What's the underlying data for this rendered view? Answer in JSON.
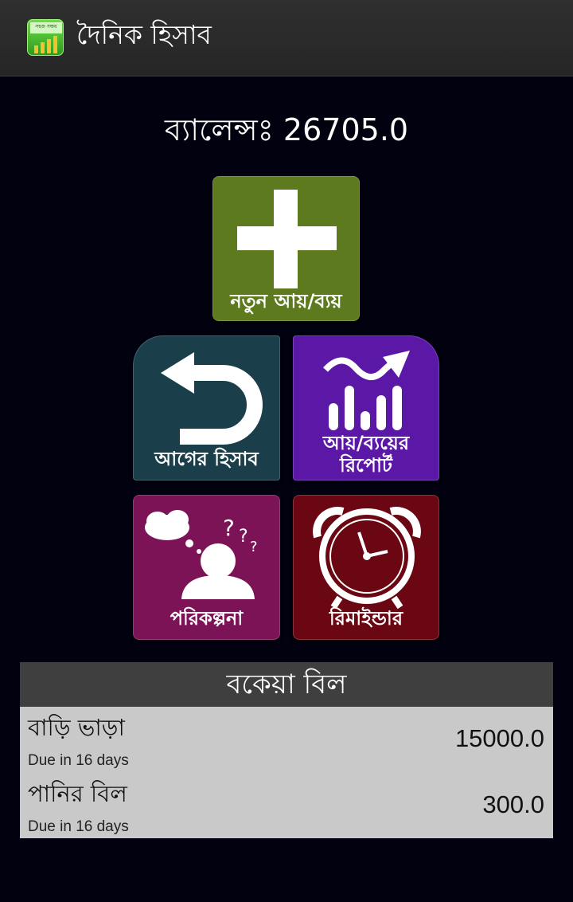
{
  "app": {
    "title": "দৈনিক হিসাব",
    "icon": "app-logo-icon",
    "icon_text": "সহজ সঞ্চয়"
  },
  "balance": {
    "text": "ব্যালেন্সঃ 26705.0"
  },
  "tiles": [
    {
      "id": "new",
      "label": "নতুন আয়/ব্যয়",
      "icon": "plus-icon",
      "color": "#5e7a1f"
    },
    {
      "id": "previous",
      "label": "আগের হিসাব",
      "icon": "return-arrow-icon",
      "color": "#1a3f4a"
    },
    {
      "id": "report",
      "label_line1": "আয়/ব্যয়ের",
      "label_line2": "রিপোর্ট",
      "icon": "trend-chart-icon",
      "color": "#5b17a6"
    },
    {
      "id": "plan",
      "label": "পরিকল্পনা",
      "icon": "thinking-person-icon",
      "color": "#7c1356"
    },
    {
      "id": "reminder",
      "label": "রিমাইন্ডার",
      "icon": "alarm-clock-icon",
      "color": "#6b0713"
    }
  ],
  "bills": {
    "header": "বকেয়া বিল",
    "items": [
      {
        "name": "বাড়ি ভাড়া",
        "due": "Due in 16 days",
        "amount": "15000.0"
      },
      {
        "name": "পানির বিল",
        "due": "Due in 16 days",
        "amount": "300.0"
      }
    ]
  }
}
